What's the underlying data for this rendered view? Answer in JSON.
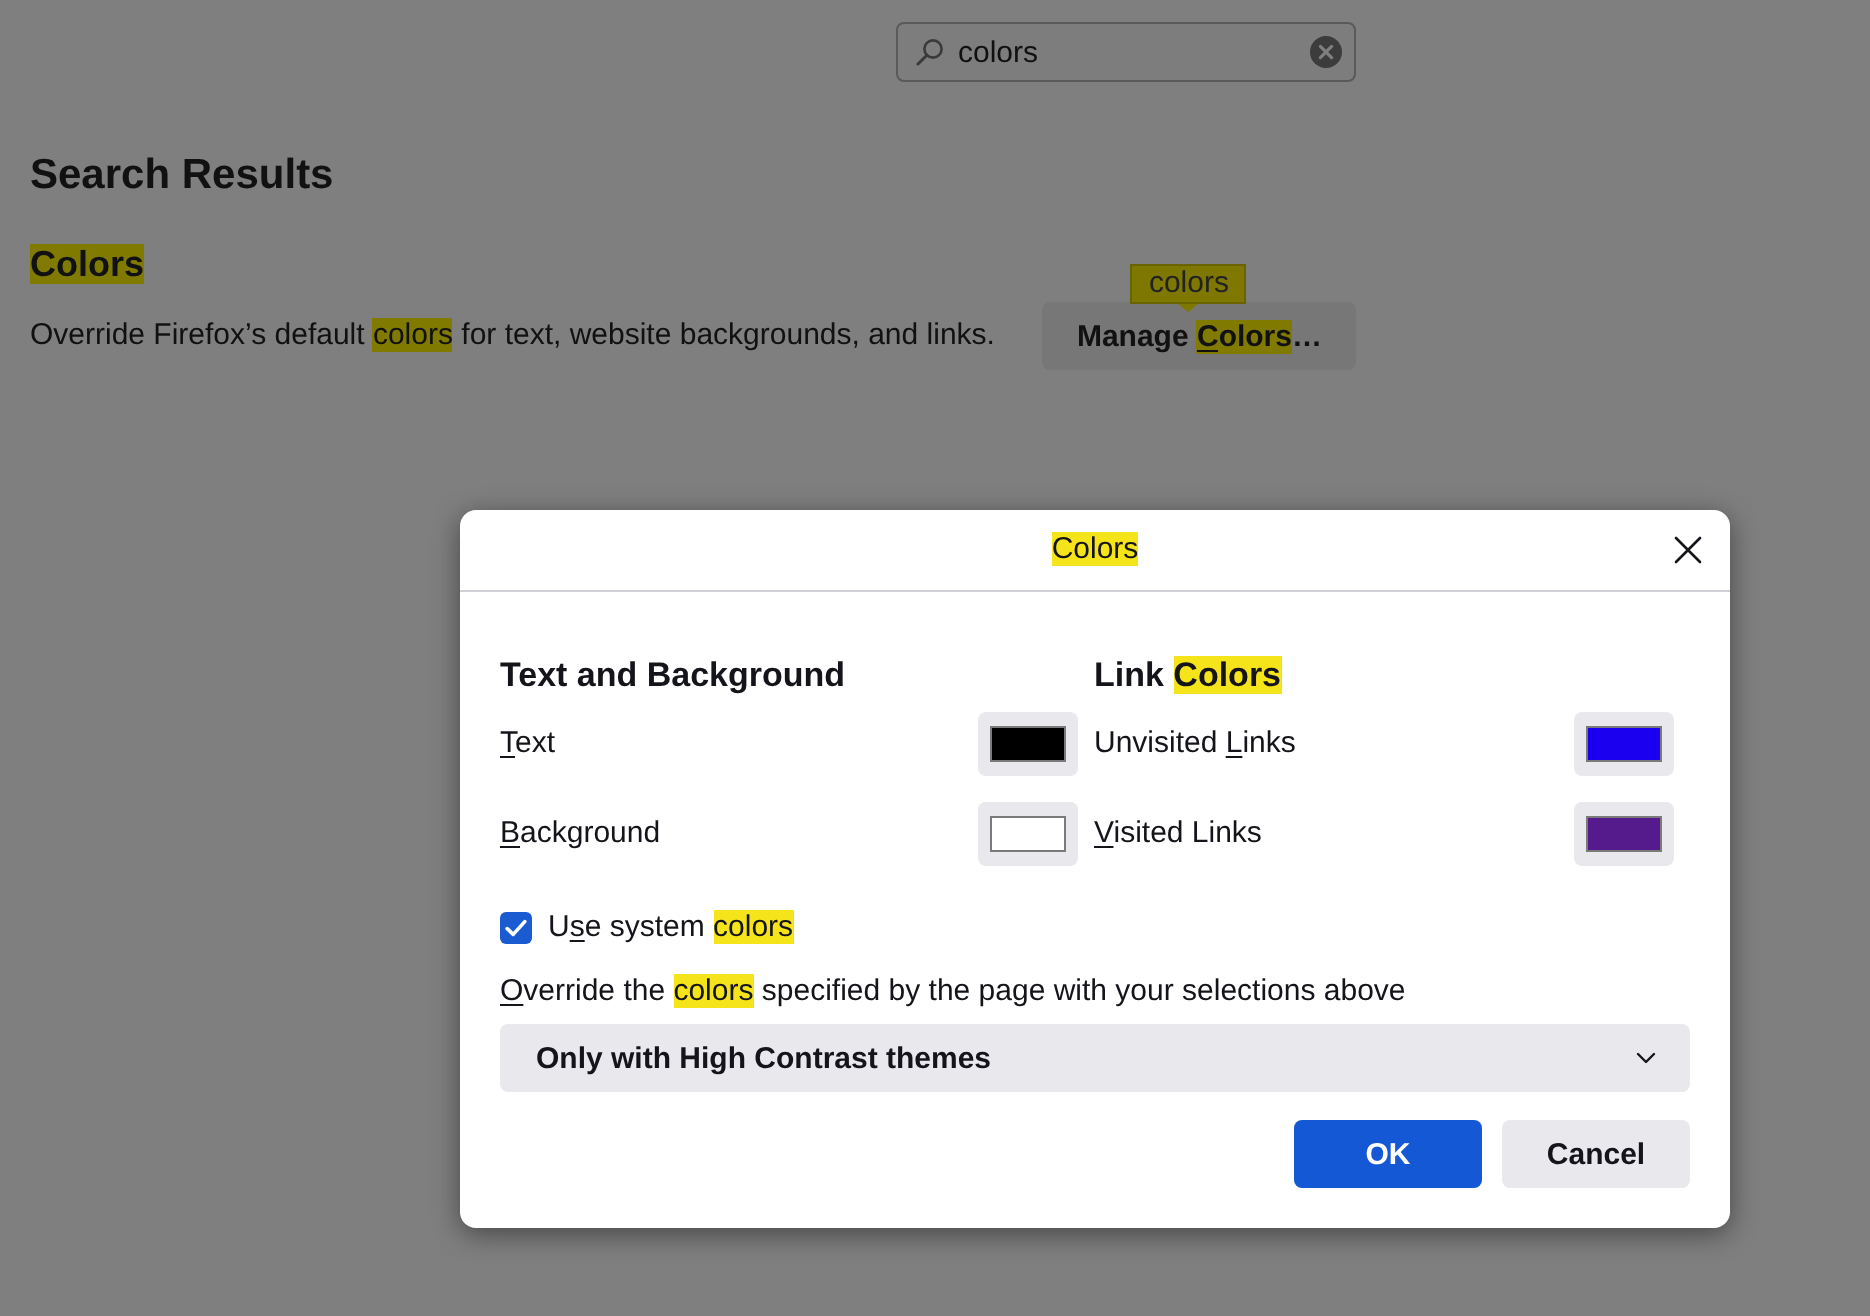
{
  "search": {
    "value": "colors"
  },
  "results": {
    "heading": "Search Results",
    "items": [
      {
        "title": [
          {
            "kind": "match",
            "text": "Colors"
          }
        ],
        "description": [
          {
            "kind": "plain",
            "text": "Override Firefox’s default "
          },
          {
            "kind": "match",
            "text": "colors"
          },
          {
            "kind": "plain",
            "text": " for text, website backgrounds, and links."
          }
        ],
        "button": [
          {
            "kind": "plain",
            "text": "Manage "
          },
          {
            "kind": "match-key",
            "text": "C"
          },
          {
            "kind": "match",
            "text": "olors"
          },
          {
            "kind": "plain",
            "text": "…"
          }
        ],
        "tooltip": "colors"
      }
    ]
  },
  "dialog": {
    "title": [
      {
        "kind": "match",
        "text": "Colors"
      }
    ],
    "groups": [
      {
        "heading": [
          {
            "kind": "plain",
            "text": "Text and Background"
          }
        ],
        "items": [
          {
            "label": [
              {
                "kind": "key",
                "text": "T"
              },
              {
                "kind": "plain",
                "text": "ext"
              }
            ],
            "color": "#000000"
          },
          {
            "label": [
              {
                "kind": "key",
                "text": "B"
              },
              {
                "kind": "plain",
                "text": "ackground"
              }
            ],
            "color": "#ffffff"
          }
        ]
      },
      {
        "heading": [
          {
            "kind": "plain",
            "text": "Link "
          },
          {
            "kind": "match",
            "text": "Colors"
          }
        ],
        "items": [
          {
            "label": [
              {
                "kind": "plain",
                "text": "Unvisited "
              },
              {
                "kind": "key",
                "text": "L"
              },
              {
                "kind": "plain",
                "text": "inks"
              }
            ],
            "color": "#1a00ee"
          },
          {
            "label": [
              {
                "kind": "key",
                "text": "V"
              },
              {
                "kind": "plain",
                "text": "isited Links"
              }
            ],
            "color": "#551a8b"
          }
        ]
      }
    ],
    "checkbox": {
      "label": [
        {
          "kind": "plain",
          "text": "U"
        },
        {
          "kind": "key",
          "text": "s"
        },
        {
          "kind": "plain",
          "text": "e system "
        },
        {
          "kind": "match",
          "text": "colors"
        }
      ],
      "checked": true
    },
    "override": {
      "label": [
        {
          "kind": "key",
          "text": "O"
        },
        {
          "kind": "plain",
          "text": "verride the "
        },
        {
          "kind": "match",
          "text": "colors"
        },
        {
          "kind": "plain",
          "text": " specified by the page with your selections above"
        }
      ],
      "value": "Only with High Contrast themes"
    },
    "buttons": [
      {
        "label": "OK",
        "kind": "primary"
      },
      {
        "label": "Cancel",
        "kind": "secondary"
      }
    ]
  }
}
